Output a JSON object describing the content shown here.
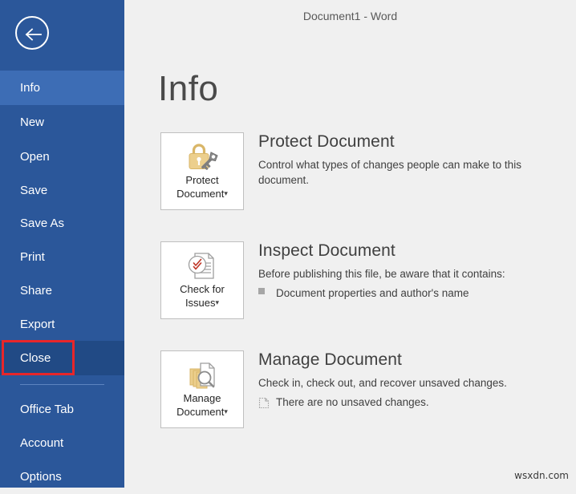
{
  "window": {
    "title": "Document1 - Word"
  },
  "sidebar": {
    "back_button_icon": "back-arrow-icon",
    "items": [
      {
        "label": "Info",
        "state": "selected"
      },
      {
        "label": "New",
        "state": "normal"
      },
      {
        "label": "Open",
        "state": "normal"
      },
      {
        "label": "Save",
        "state": "normal"
      },
      {
        "label": "Save As",
        "state": "normal"
      },
      {
        "label": "Print",
        "state": "normal"
      },
      {
        "label": "Share",
        "state": "normal"
      },
      {
        "label": "Export",
        "state": "normal"
      },
      {
        "label": "Close",
        "state": "dark-highlight"
      },
      {
        "label": "Office Tab",
        "state": "normal"
      },
      {
        "label": "Account",
        "state": "normal"
      },
      {
        "label": "Options",
        "state": "normal"
      }
    ]
  },
  "annotation": {
    "target": "Close",
    "color": "#e8262a"
  },
  "main": {
    "heading": "Info",
    "sections": [
      {
        "tile_label_line1": "Protect",
        "tile_label_line2": "Document",
        "tile_caret": "▾",
        "tile_icon": "lock-and-key-icon",
        "title": "Protect Document",
        "description": "Control what types of changes people can make to this document.",
        "details": []
      },
      {
        "tile_label_line1": "Check for",
        "tile_label_line2": "Issues",
        "tile_caret": "▾",
        "tile_icon": "document-checkmark-icon",
        "title": "Inspect Document",
        "description": "Before publishing this file, be aware that it contains:",
        "details": [
          {
            "icon": "square-bullet-icon",
            "text": "Document properties and author's name"
          }
        ]
      },
      {
        "tile_label_line1": "Manage",
        "tile_label_line2": "Document",
        "tile_caret": "▾",
        "tile_icon": "documents-magnifier-icon",
        "title": "Manage Document",
        "description": "Check in, check out, and recover unsaved changes.",
        "details": [
          {
            "icon": "dotted-document-icon",
            "text": "There are no unsaved changes."
          }
        ]
      }
    ]
  },
  "watermark": {
    "text": "wsxdn.com"
  },
  "colors": {
    "sidebar_blue": "#2b579a",
    "sidebar_selected": "#3d6db5",
    "sidebar_dark": "#214a85",
    "annotation_red": "#e8262a",
    "content_bg": "#f0f0f0",
    "gold": "#e3c37a"
  }
}
